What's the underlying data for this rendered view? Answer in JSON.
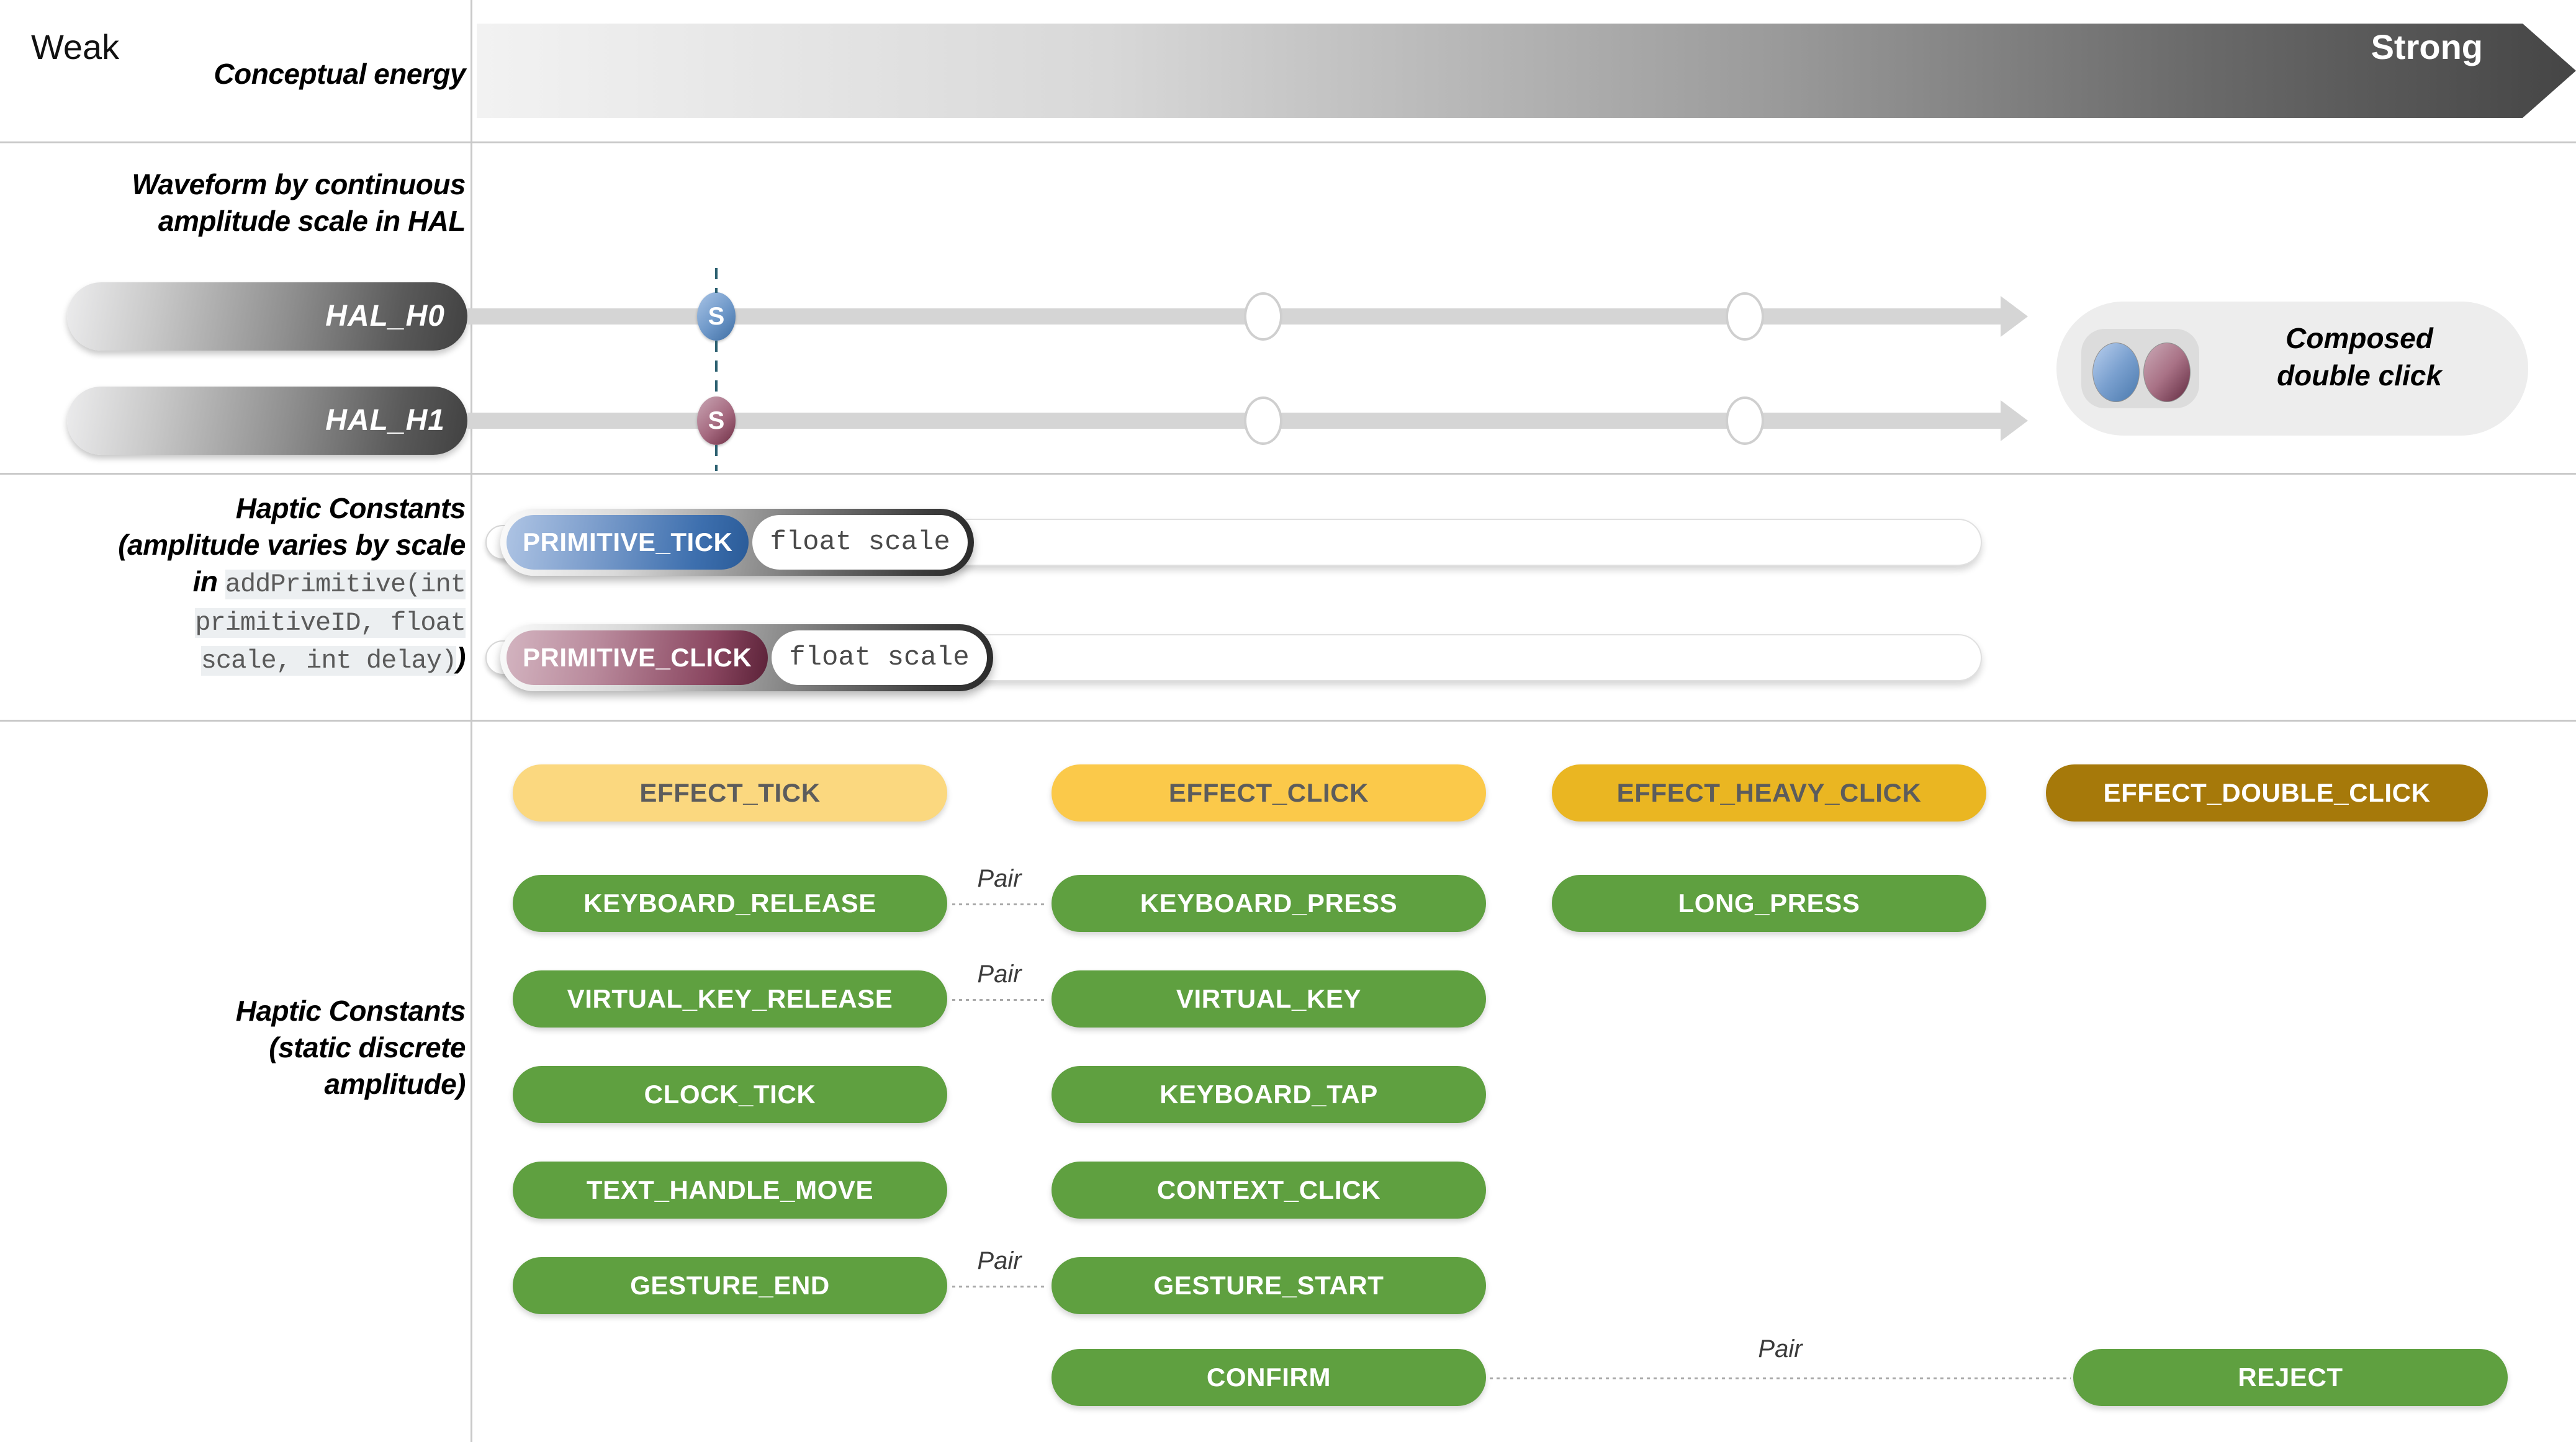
{
  "rows": {
    "conceptual": {
      "label": "Conceptual energy",
      "weak": "Weak",
      "strong": "Strong",
      "gradient_from": "#f2f2f2",
      "gradient_to": "#454545"
    },
    "waveform": {
      "label_line1": "Waveform by continuous",
      "label_line2": "amplitude scale in HAL",
      "hal0": "HAL_H0",
      "hal1": "HAL_H1",
      "node_marker": "S",
      "blue": "#3f6ea3",
      "maroon": "#6e2f45",
      "composed": {
        "line1": "Composed",
        "line2": "double click"
      }
    },
    "primitives": {
      "label_line1": "Haptic Constants",
      "label_line2": "(amplitude varies by scale",
      "label_in": "in ",
      "code_line1": "addPrimitive(int",
      "code_line2": "primitiveID, float",
      "code_line3": "scale, int delay)",
      "label_close": ")",
      "items": [
        {
          "name": "PRIMITIVE_TICK",
          "value": "float scale",
          "color": "blue"
        },
        {
          "name": "PRIMITIVE_CLICK",
          "value": "float scale",
          "color": "maroon"
        }
      ]
    },
    "constants": {
      "label_line1": "Haptic Constants",
      "label_line2": "(static discrete",
      "label_line3": "amplitude)",
      "effects": [
        {
          "label": "EFFECT_TICK",
          "tone": "amber1"
        },
        {
          "label": "EFFECT_CLICK",
          "tone": "amber2"
        },
        {
          "label": "EFFECT_HEAVY_CLICK",
          "tone": "amber3"
        },
        {
          "label": "EFFECT_DOUBLE_CLICK",
          "tone": "amber4"
        }
      ],
      "chips": [
        {
          "label": "KEYBOARD_RELEASE",
          "col": 0,
          "row": 0
        },
        {
          "label": "KEYBOARD_PRESS",
          "col": 1,
          "row": 0
        },
        {
          "label": "LONG_PRESS",
          "col": 2,
          "row": 0
        },
        {
          "label": "VIRTUAL_KEY_RELEASE",
          "col": 0,
          "row": 1
        },
        {
          "label": "VIRTUAL_KEY",
          "col": 1,
          "row": 1
        },
        {
          "label": "CLOCK_TICK",
          "col": 0,
          "row": 2
        },
        {
          "label": "KEYBOARD_TAP",
          "col": 1,
          "row": 2
        },
        {
          "label": "TEXT_HANDLE_MOVE",
          "col": 0,
          "row": 3
        },
        {
          "label": "CONTEXT_CLICK",
          "col": 1,
          "row": 3
        },
        {
          "label": "GESTURE_END",
          "col": 0,
          "row": 4
        },
        {
          "label": "GESTURE_START",
          "col": 1,
          "row": 4
        },
        {
          "label": "CONFIRM",
          "col": 1,
          "row": 5
        },
        {
          "label": "REJECT",
          "col": 3,
          "row": 5
        }
      ],
      "pairs": [
        {
          "label": "Pair",
          "row": 0
        },
        {
          "label": "Pair",
          "row": 1
        },
        {
          "label": "Pair",
          "row": 4
        },
        {
          "label": "Pair",
          "row": 5
        }
      ],
      "green": "#5fa040"
    }
  }
}
